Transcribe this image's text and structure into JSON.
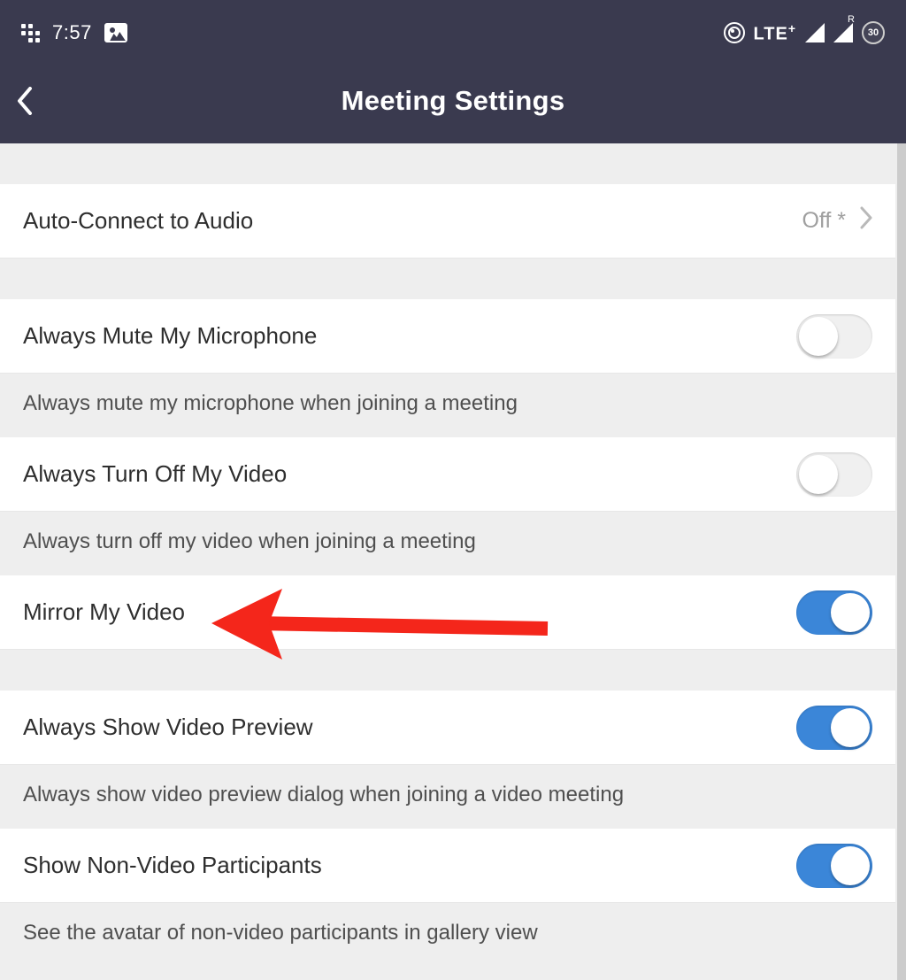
{
  "statusBar": {
    "time": "7:57",
    "networkLabel": "LTE",
    "networkPlus": "+",
    "roamingLabel": "R",
    "batteryLabel": "30"
  },
  "header": {
    "title": "Meeting Settings"
  },
  "settings": {
    "autoConnect": {
      "label": "Auto-Connect to Audio",
      "value": "Off *"
    },
    "muteMic": {
      "label": "Always Mute My Microphone",
      "desc": "Always mute my microphone when joining a meeting"
    },
    "turnOffVideo": {
      "label": "Always Turn Off My Video",
      "desc": "Always turn off my video when joining a meeting"
    },
    "mirrorVideo": {
      "label": "Mirror My Video"
    },
    "videoPreview": {
      "label": "Always Show Video Preview",
      "desc": "Always show video preview dialog when joining a video meeting"
    },
    "nonVideo": {
      "label": "Show Non-Video Participants",
      "desc": "See the avatar of non-video participants in gallery view"
    }
  }
}
